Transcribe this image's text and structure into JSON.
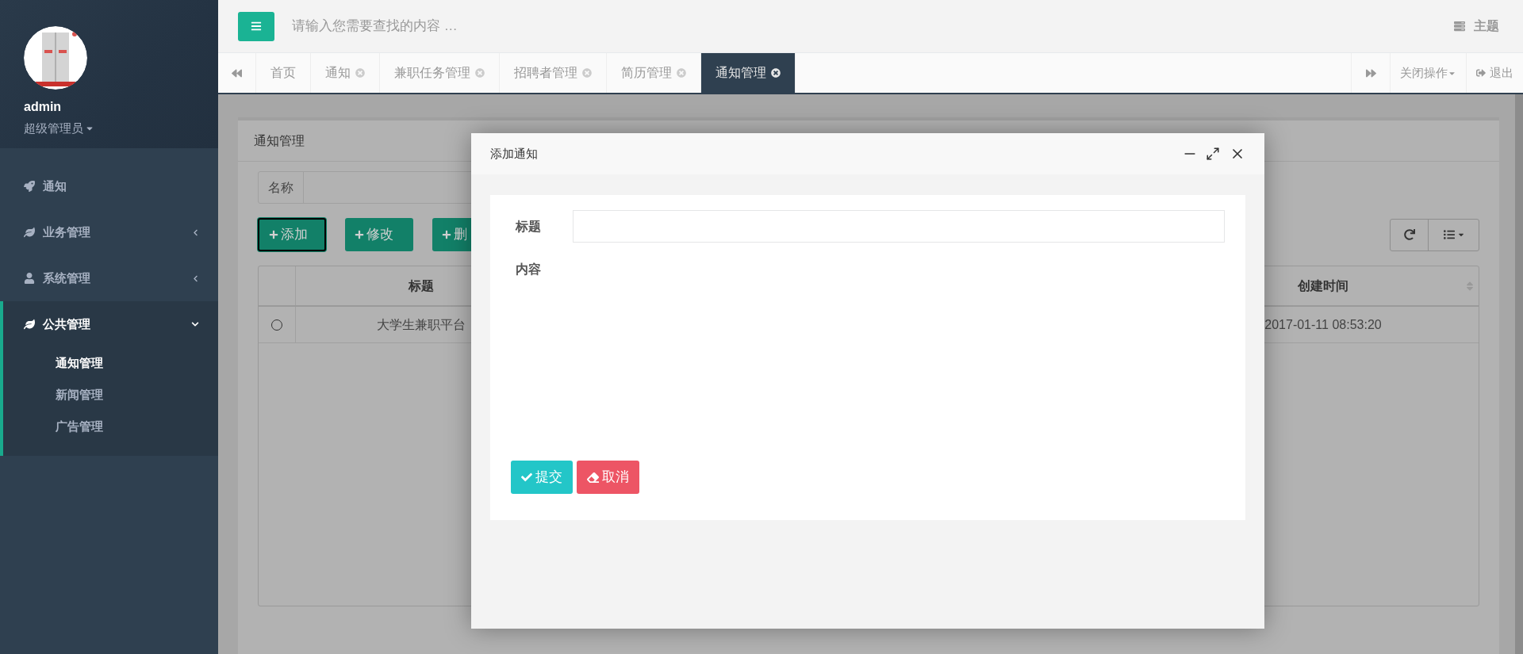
{
  "sidebar": {
    "user": {
      "name": "admin",
      "role": "超级管理员"
    },
    "menu": [
      {
        "label": "通知",
        "kind": "link"
      },
      {
        "label": "业务管理",
        "kind": "submenu",
        "expanded": false
      },
      {
        "label": "系统管理",
        "kind": "submenu",
        "expanded": false
      },
      {
        "label": "公共管理",
        "kind": "submenu",
        "expanded": true,
        "children": [
          {
            "label": "通知管理",
            "selected": true
          },
          {
            "label": "新闻管理",
            "selected": false
          },
          {
            "label": "广告管理",
            "selected": false
          }
        ]
      }
    ]
  },
  "topbar": {
    "search": {
      "placeholder": "请输入您需要查找的内容 …"
    },
    "theme": "主题"
  },
  "tabs": [
    {
      "label": "首页",
      "closable": false,
      "selected": false
    },
    {
      "label": "通知",
      "closable": true,
      "selected": false
    },
    {
      "label": "兼职任务管理",
      "closable": true,
      "selected": false
    },
    {
      "label": "招聘者管理",
      "closable": true,
      "selected": false
    },
    {
      "label": "简历管理",
      "closable": true,
      "selected": false
    },
    {
      "label": "通知管理",
      "closable": true,
      "selected": true
    }
  ],
  "tab_actions": {
    "close_ops": "关闭操作",
    "logout": "退出"
  },
  "page": {
    "title": "通知管理",
    "filter": {
      "label": "名称"
    },
    "buttons": [
      {
        "label": "添加",
        "focused": true
      },
      {
        "label": "修改",
        "focused": false
      },
      {
        "label": "删",
        "focused": false
      }
    ],
    "table": {
      "columns": [
        "标题",
        "创建时间"
      ],
      "rows": [
        {
          "selected": false,
          "cells": [
            "大学生兼职平台",
            "2017-01-11 08:53:20"
          ]
        }
      ]
    }
  },
  "dialog": {
    "title": "添加通知",
    "fields": [
      {
        "label": "标题",
        "kind": "input"
      },
      {
        "label": "内容",
        "kind": "editor"
      }
    ],
    "buttons": [
      {
        "label": "提交",
        "kind": "primary"
      },
      {
        "label": "取消",
        "kind": "danger"
      }
    ]
  }
}
